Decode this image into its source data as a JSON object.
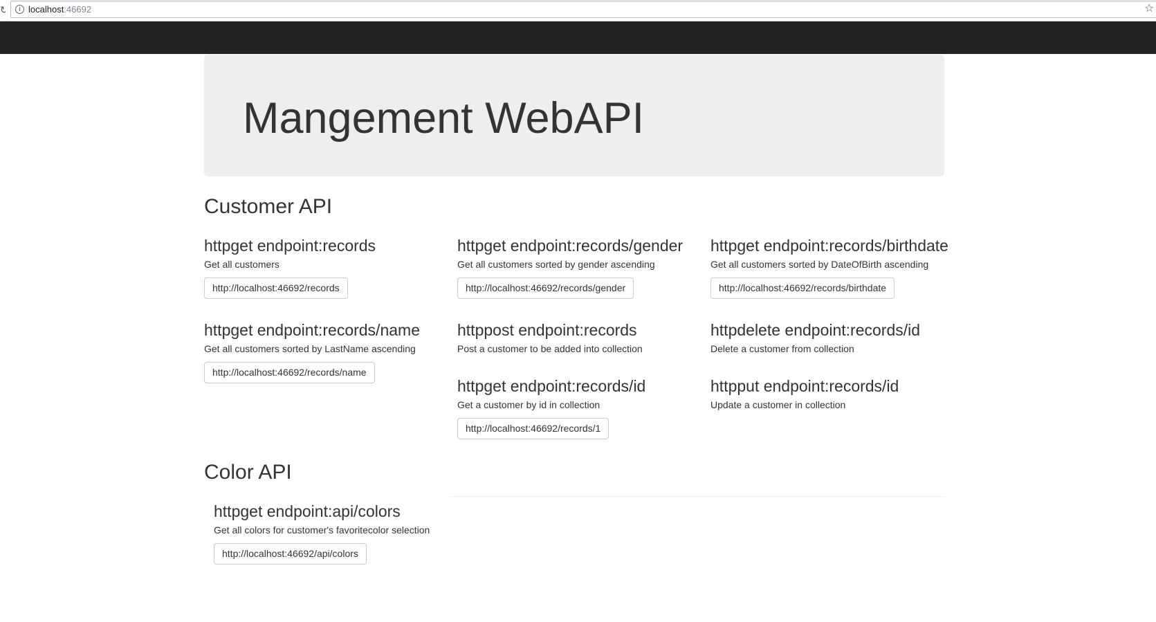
{
  "browser": {
    "url_host": "localhost",
    "url_port": ":46692"
  },
  "jumbotron": {
    "title": "Mangement WebAPI"
  },
  "customer_api": {
    "title": "Customer API",
    "endpoints": [
      {
        "heading": "httpget endpoint:records",
        "description": "Get all customers",
        "link": "http://localhost:46692/records"
      },
      {
        "heading": "httpget endpoint:records/gender",
        "description": "Get all customers sorted by gender ascending",
        "link": "http://localhost:46692/records/gender"
      },
      {
        "heading": "httpget endpoint:records/birthdate",
        "description": "Get all customers sorted by DateOfBirth ascending",
        "link": "http://localhost:46692/records/birthdate"
      },
      {
        "heading": "httpget endpoint:records/name",
        "description": "Get all customers sorted by LastName ascending",
        "link": "http://localhost:46692/records/name"
      },
      {
        "heading": "httppost endpoint:records",
        "description": "Post a customer to be added into collection"
      },
      {
        "heading": "httpdelete endpoint:records/id",
        "description": "Delete a customer from collection"
      },
      {
        "heading": "httpget endpoint:records/id",
        "description": "Get a customer by id in collection",
        "link": "http://localhost:46692/records/1"
      },
      {
        "heading": "httpput endpoint:records/id",
        "description": "Update a customer in collection"
      }
    ]
  },
  "color_api": {
    "title": "Color API",
    "endpoints": [
      {
        "heading": "httpget endpoint:api/colors",
        "description": "Get all colors for customer's favoritecolor selection",
        "link": "http://localhost:46692/api/colors"
      }
    ]
  }
}
